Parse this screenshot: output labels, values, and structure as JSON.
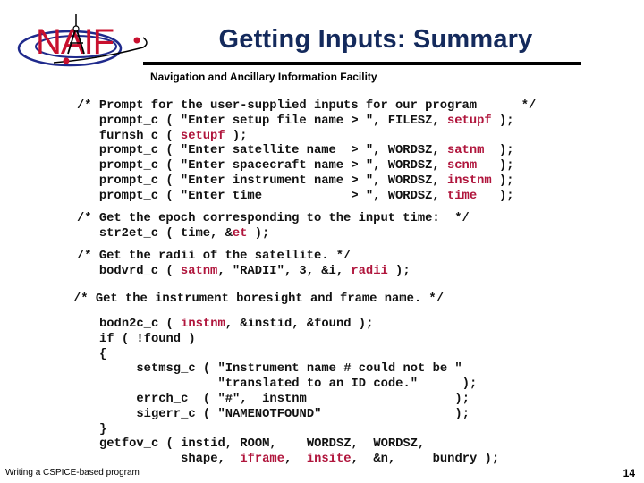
{
  "header": {
    "logo_text": "NAIF",
    "title": "Getting Inputs:  Summary",
    "subtitle": "Navigation and Ancillary Information Facility"
  },
  "colors": {
    "title": "#142a5c",
    "logo_red": "#c8102e",
    "logo_orbit": "#1f2a8c",
    "highlight": "#b0153c"
  },
  "code_blocks": [
    {
      "id": "prompt-block",
      "lines": [
        [
          {
            "t": "/* Prompt for the user-supplied inputs for our program      */"
          }
        ],
        [
          {
            "t": "   prompt_c ( \"Enter setup file name > \", FILESZ, "
          },
          {
            "t": "setupf",
            "h": true
          },
          {
            "t": " );"
          }
        ],
        [
          {
            "t": "   furnsh_c ( "
          },
          {
            "t": "setupf",
            "h": true
          },
          {
            "t": " );"
          }
        ],
        [
          {
            "t": "   prompt_c ( \"Enter satellite name  > \", WORDSZ, "
          },
          {
            "t": "satnm",
            "h": true
          },
          {
            "t": "  );"
          }
        ],
        [
          {
            "t": "   prompt_c ( \"Enter spacecraft name > \", WORDSZ, "
          },
          {
            "t": "scnm",
            "h": true
          },
          {
            "t": "   );"
          }
        ],
        [
          {
            "t": "   prompt_c ( \"Enter instrument name > \", WORDSZ, "
          },
          {
            "t": "instnm",
            "h": true
          },
          {
            "t": " );"
          }
        ],
        [
          {
            "t": "   prompt_c ( \"Enter time            > \", WORDSZ, "
          },
          {
            "t": "time",
            "h": true
          },
          {
            "t": "   );"
          }
        ]
      ]
    },
    {
      "id": "epoch-block",
      "lines": [
        [
          {
            "t": "/* Get the epoch corresponding to the input time:  */"
          }
        ],
        [
          {
            "t": "   str2et_c ( time, &"
          },
          {
            "t": "et",
            "h": true
          },
          {
            "t": " );"
          }
        ]
      ]
    },
    {
      "id": "radii-block",
      "lines": [
        [
          {
            "t": "/* Get the radii of the satellite. */"
          }
        ],
        [
          {
            "t": "   bodvrd_c ( "
          },
          {
            "t": "satnm",
            "h": true
          },
          {
            "t": ", \"RADII\", 3, &i, "
          },
          {
            "t": "radii",
            "h": true
          },
          {
            "t": " );"
          }
        ]
      ]
    },
    {
      "id": "boresight-comment",
      "lines": [
        [
          {
            "t": "/* Get the instrument boresight and frame name. */"
          }
        ]
      ]
    },
    {
      "id": "boresight-block",
      "lines": [
        [
          {
            "t": "bodn2c_c ( "
          },
          {
            "t": "instnm",
            "h": true
          },
          {
            "t": ", &instid, &found );"
          }
        ],
        [
          {
            "t": "if ( !found )"
          }
        ],
        [
          {
            "t": "{"
          }
        ],
        [
          {
            "t": "     setmsg_c ( \"Instrument name # could not be \""
          }
        ],
        [
          {
            "t": "                \"translated to an ID code.\"      );"
          }
        ],
        [
          {
            "t": "     errch_c  ( \"#\",  instnm                    );"
          }
        ],
        [
          {
            "t": "     sigerr_c ( \"NAMENOTFOUND\"                  );"
          }
        ],
        [
          {
            "t": "}"
          }
        ],
        [
          {
            "t": "getfov_c ( instid, ROOM,    WORDSZ,  WORDSZ,"
          }
        ],
        [
          {
            "t": "           shape,  "
          },
          {
            "t": "iframe",
            "h": true
          },
          {
            "t": ",  "
          },
          {
            "t": "insite",
            "h": true
          },
          {
            "t": ",  &n,     bundry );"
          }
        ]
      ]
    }
  ],
  "footer": {
    "left_text": "Writing a CSPICE-based program",
    "page_number": "14"
  }
}
